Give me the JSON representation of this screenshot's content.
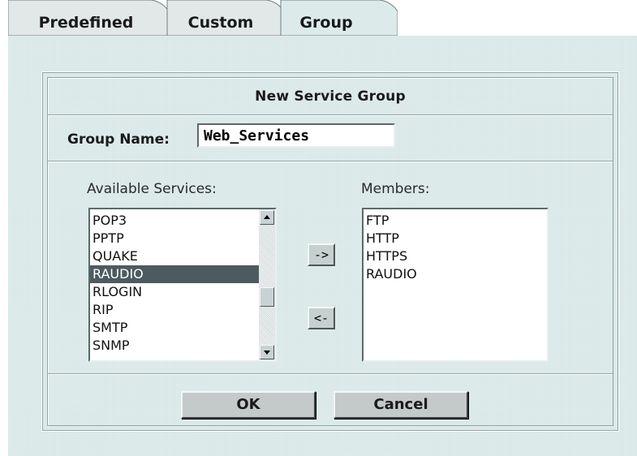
{
  "tabs": [
    {
      "label": "Predefined",
      "active": false
    },
    {
      "label": "Custom",
      "active": false
    },
    {
      "label": "Group",
      "active": true
    }
  ],
  "dialog": {
    "title": "New Service Group",
    "group_name_label": "Group Name:",
    "group_name_value": "Web_Services",
    "available_label": "Available Services:",
    "members_label": "Members:",
    "available_services": [
      "POP3",
      "PPTP",
      "QUAKE",
      "RAUDIO",
      "RLOGIN",
      "RIP",
      "SMTP",
      "SNMP"
    ],
    "selected_available": "RAUDIO",
    "members": [
      "FTP",
      "HTTP",
      "HTTPS",
      "RAUDIO"
    ],
    "add_label": "->",
    "remove_label": "<-",
    "ok_label": "OK",
    "cancel_label": "Cancel"
  },
  "colors": {
    "panel_bg": "#dcebea",
    "tab_active": "#dcebea",
    "tab_inactive": "#e2e8e8",
    "selection": "#4d5b60",
    "button_face": "#c4c9c9"
  }
}
